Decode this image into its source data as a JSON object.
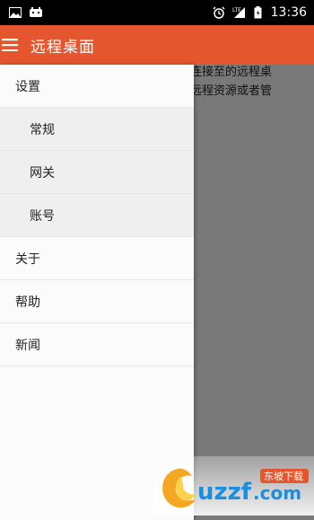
{
  "status_bar": {
    "time": "13:36",
    "icons": [
      "image-icon",
      "android-icon",
      "alarm-icon",
      "signal-icon",
      "battery-icon"
    ]
  },
  "app_bar": {
    "title": "远程桌面",
    "background_color": "#e4572e"
  },
  "background_content": {
    "line1": "连接至的远程桌",
    "line2": "远程资源或者管"
  },
  "drawer": {
    "settings": "设置",
    "general": "常规",
    "gateway": "网关",
    "account": "账号",
    "about": "关于",
    "help": "帮助",
    "news": "新闻"
  },
  "watermark": {
    "text": "东坡下载",
    "site": "uzzf.com"
  }
}
